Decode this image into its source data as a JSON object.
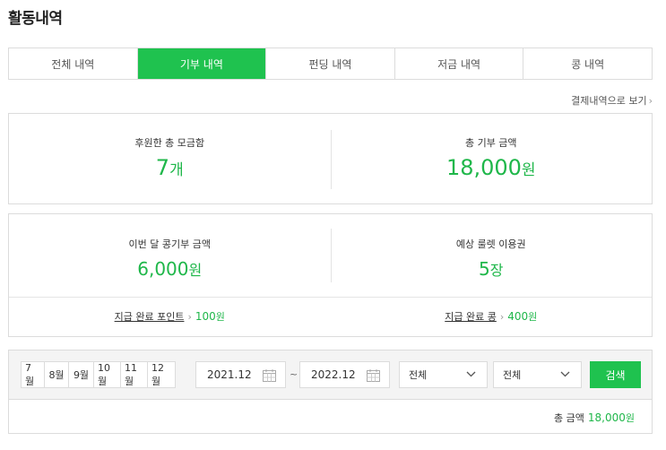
{
  "page_title": "활동내역",
  "tabs": [
    {
      "label": "전체 내역",
      "active": false
    },
    {
      "label": "기부 내역",
      "active": true
    },
    {
      "label": "펀딩 내역",
      "active": false
    },
    {
      "label": "저금 내역",
      "active": false
    },
    {
      "label": "콩 내역",
      "active": false
    }
  ],
  "payment_link": "결제내역으로 보기",
  "summary": {
    "funds_label": "후원한 총 모금함",
    "funds_value": "7",
    "funds_unit": "개",
    "total_label": "총 기부 금액",
    "total_value": "18,000",
    "total_unit": "원"
  },
  "monthly": {
    "bean_label": "이번 달 콩기부 금액",
    "bean_value": "6,000",
    "bean_unit": "원",
    "roulette_label": "예상 룰렛 이용권",
    "roulette_value": "5",
    "roulette_unit": "장",
    "points_label": "지급 완료 포인트",
    "points_value": "100",
    "points_unit": "원",
    "beans_label": "지급 완료 콩",
    "beans_value": "400",
    "beans_unit": "원"
  },
  "filter": {
    "months": [
      "7월",
      "8월",
      "9월",
      "10월",
      "11월",
      "12월"
    ],
    "start_date": "2021.12",
    "tilde": "~",
    "end_date": "2022.12",
    "select1": "전체",
    "select2": "전체",
    "search_label": "검색"
  },
  "total_bar": {
    "label": "총 금액",
    "value": "18,000",
    "unit": "원"
  },
  "colors": {
    "accent": "#1fc24f",
    "accent_text": "#1fb74a"
  }
}
